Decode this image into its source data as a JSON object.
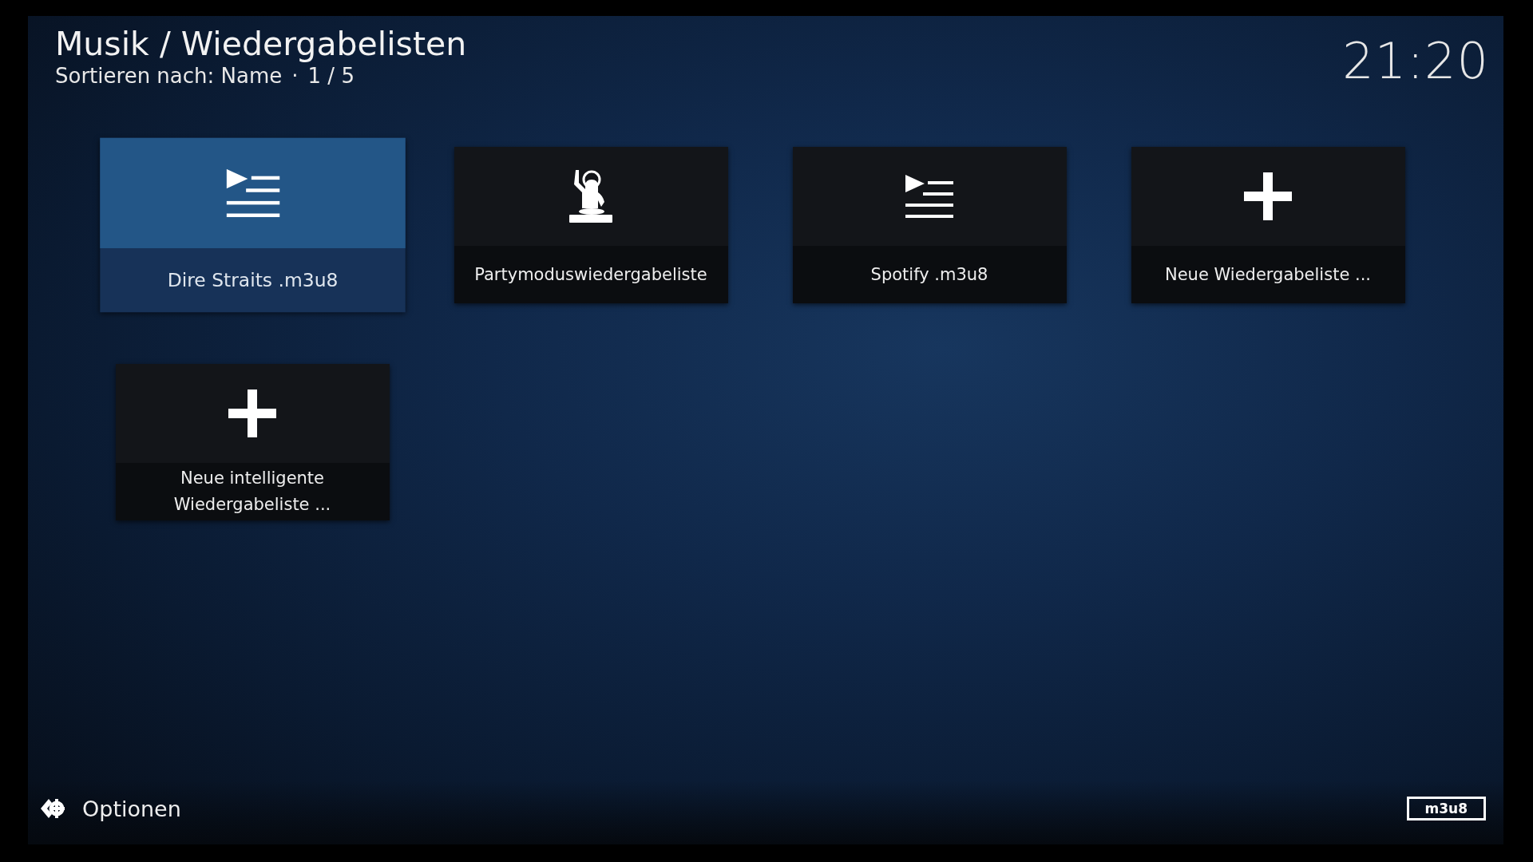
{
  "header": {
    "title": "Musik / Wiedergabelisten",
    "sort_label": "Sortieren nach: Name",
    "separator": "·",
    "position": "1 / 5"
  },
  "clock": "21:20",
  "items": [
    {
      "label": "Dire Straits .m3u8",
      "kind": "playlist",
      "selected": true
    },
    {
      "label": "Partymoduswiedergabeliste",
      "kind": "party",
      "selected": false
    },
    {
      "label": "Spotify .m3u8",
      "kind": "playlist",
      "selected": false
    },
    {
      "label": "Neue Wiedergabeliste ...",
      "kind": "add",
      "selected": false
    },
    {
      "label": "Neue intelligente Wiedergabeliste ...",
      "kind": "add",
      "selected": false
    }
  ],
  "footer": {
    "options": "Optionen",
    "badge": "m3u8"
  }
}
